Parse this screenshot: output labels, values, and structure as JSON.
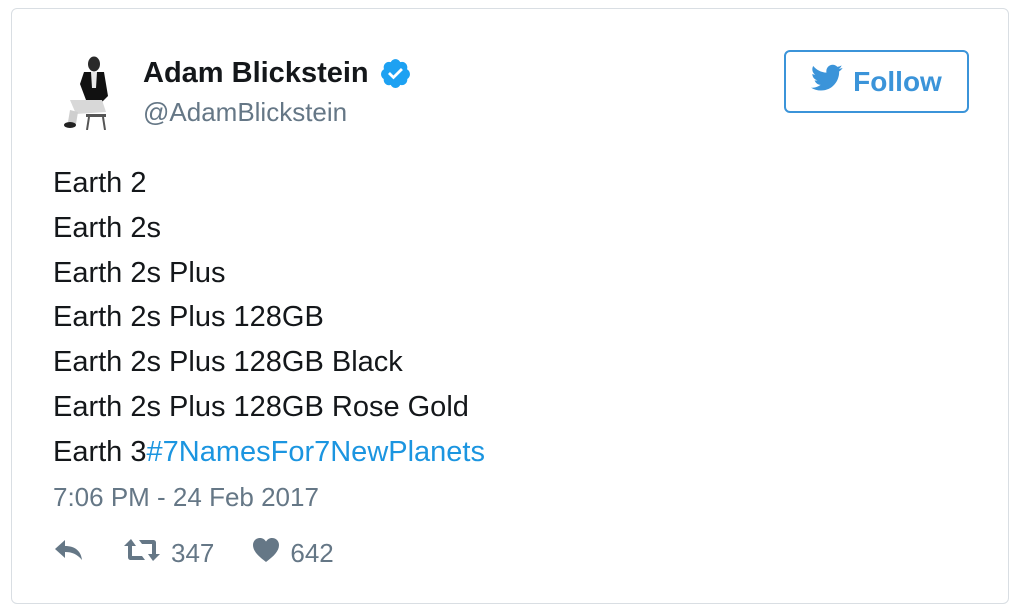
{
  "author": {
    "name": "Adam Blickstein",
    "handle": "@AdamBlickstein",
    "verified": true
  },
  "follow_button": {
    "label": "Follow",
    "icon": "twitter-bird-icon"
  },
  "tweet": {
    "lines": [
      "Earth 2",
      "Earth 2s",
      "Earth 2s Plus",
      "Earth 2s Plus 128GB",
      "Earth 2s Plus 128GB Black",
      "Earth 2s Plus 128GB Rose Gold"
    ],
    "last_line_text": "Earth 3",
    "hashtag": "#7NamesFor7NewPlanets"
  },
  "timestamp": "7:06 PM - 24 Feb 2017",
  "actions": {
    "reply_icon": "reply-icon",
    "retweet_icon": "retweet-icon",
    "retweet_count": "347",
    "like_icon": "heart-icon",
    "like_count": "642"
  },
  "colors": {
    "link": "#1b95e0",
    "follow_accent": "#3b94d9",
    "verified": "#1da1f2",
    "secondary_text": "#657786"
  }
}
